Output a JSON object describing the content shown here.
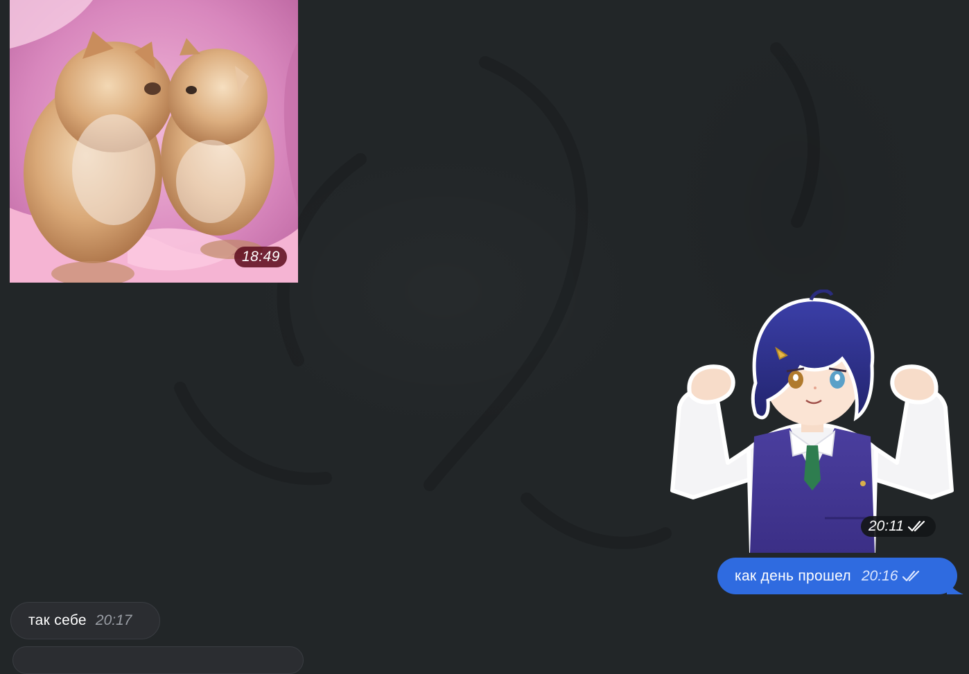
{
  "messages": {
    "video": {
      "time": "18:49"
    },
    "sticker": {
      "time": "20:11",
      "status_icon": "double-check-icon"
    },
    "outgoing_text": {
      "text": "как день прошел",
      "time": "20:16",
      "status_icon": "double-check-icon"
    },
    "incoming_text": {
      "text": "так себе",
      "time": "20:17"
    }
  },
  "colors": {
    "chat_background": "#222628",
    "outgoing_bubble": "#2f6be0",
    "incoming_bubble": "#2b2d31",
    "video_time_badge": "#601020"
  }
}
